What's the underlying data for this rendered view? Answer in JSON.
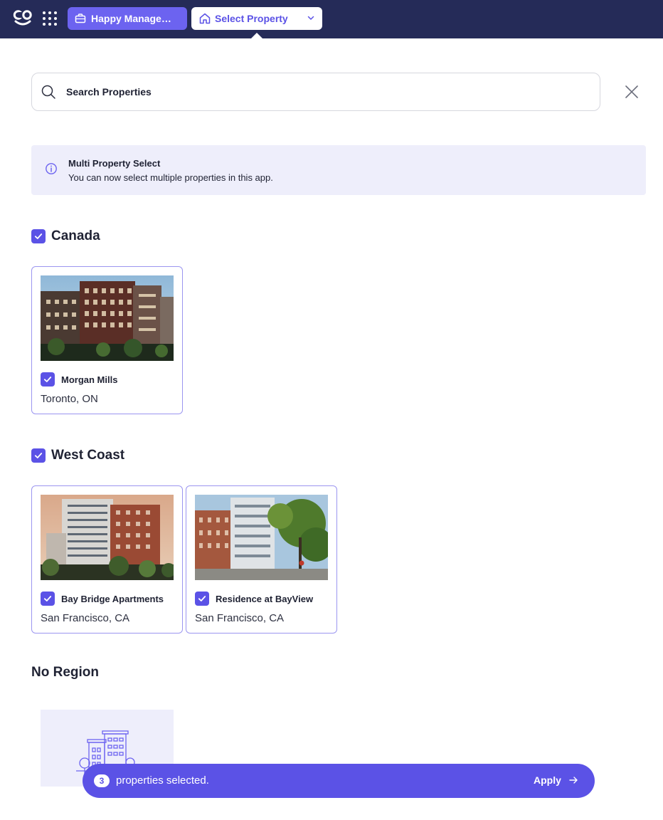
{
  "topbar": {
    "logo_text": "co",
    "company_label": "Happy Management",
    "property_label": "Select Property",
    "colors": {
      "bar": "#252b58",
      "accent": "#6c63f0"
    }
  },
  "search": {
    "placeholder": "Search Properties",
    "value": ""
  },
  "info": {
    "title": "Multi Property Select",
    "text": "You can now select multiple properties in this app."
  },
  "groups": [
    {
      "name": "Canada",
      "checked": true,
      "properties": [
        {
          "name": "Morgan Mills",
          "location": "Toronto, ON",
          "checked": true
        }
      ]
    },
    {
      "name": "West Coast",
      "checked": true,
      "properties": [
        {
          "name": "Bay Bridge Apartments",
          "location": "San Francisco, CA",
          "checked": true
        },
        {
          "name": "Residence at BayView",
          "location": "San Francisco, CA",
          "checked": true
        }
      ]
    }
  ],
  "no_region": {
    "title": "No Region"
  },
  "selection": {
    "count": "3",
    "text": "properties selected.",
    "apply_label": "Apply"
  },
  "icons": [
    "co-logo-icon",
    "apps-grid-icon",
    "briefcase-icon",
    "home-icon",
    "chevron-down-icon",
    "search-icon",
    "close-icon",
    "info-icon",
    "checkmark-icon",
    "building-illustration-icon",
    "arrow-right-icon"
  ]
}
